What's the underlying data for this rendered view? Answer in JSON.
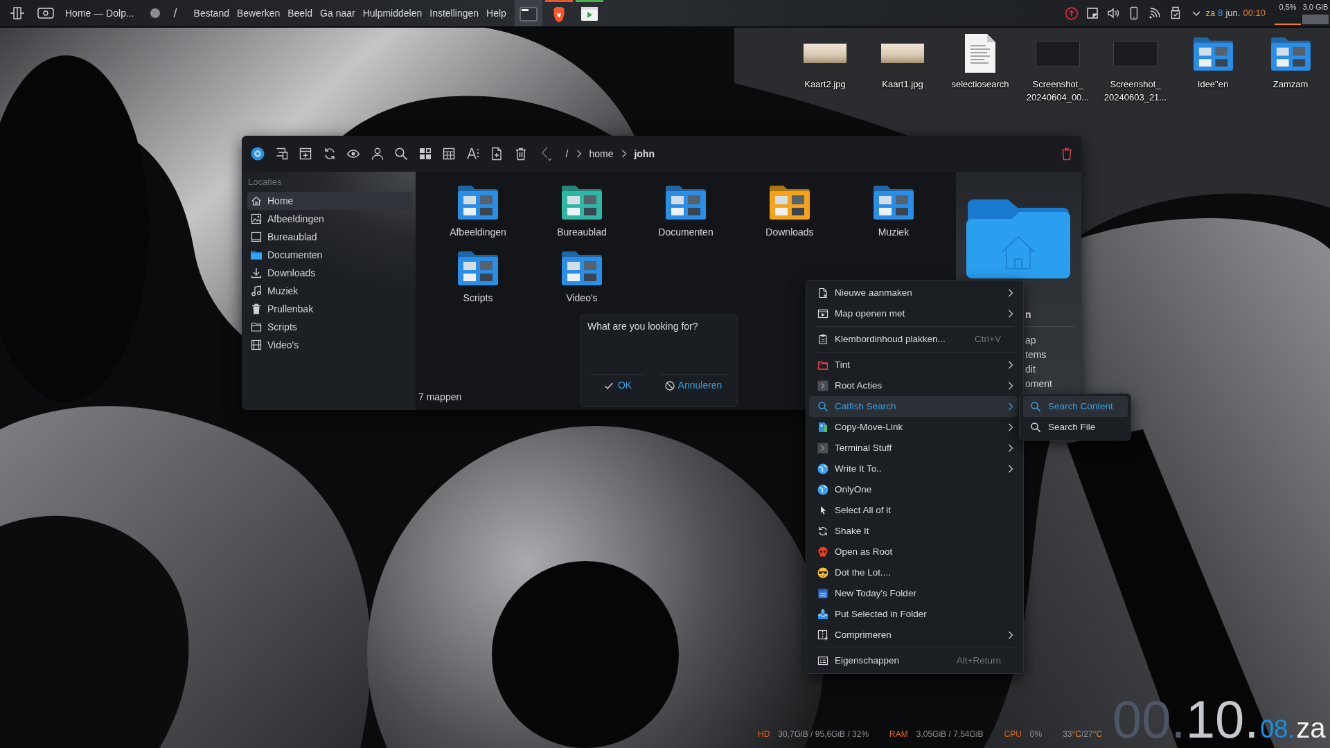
{
  "top_panel": {
    "window_title": "Home — Dolp...",
    "separator": "/",
    "menu": [
      "Bestand",
      "Bewerken",
      "Beeld",
      "Ga naar",
      "Hulpmiddelen",
      "Instellingen",
      "Help"
    ],
    "tasks": [
      {
        "selected": true
      },
      {
        "selected": false,
        "color": "#e4572e"
      },
      {
        "selected": false,
        "color": "#4caf50"
      }
    ],
    "datetime": {
      "weekday": "za",
      "day": "8",
      "month": "jun.",
      "time": "00:10"
    },
    "cpu_usage": "0,5%",
    "memory_usage": "3,0 GiB"
  },
  "desktop_icons": [
    {
      "kind": "photo",
      "label": [
        "Kaart2.jpg"
      ]
    },
    {
      "kind": "photo",
      "label": [
        "Kaart1.jpg"
      ]
    },
    {
      "kind": "document",
      "label": [
        "selectiosearch"
      ]
    },
    {
      "kind": "screenshot",
      "label": [
        "Screenshot_",
        "20240604_00..."
      ]
    },
    {
      "kind": "screenshot",
      "label": [
        "Screenshot_",
        "20240603_21..."
      ]
    },
    {
      "kind": "folder",
      "label": [
        "Idee\"en"
      ]
    },
    {
      "kind": "folder",
      "label": [
        "Zamzam"
      ]
    }
  ],
  "file_manager": {
    "breadcrumb": {
      "root": "/",
      "crumbs": [
        {
          "label": "home",
          "selected": false
        },
        {
          "label": "john",
          "selected": true
        }
      ]
    },
    "sidebar": {
      "heading": "Locaties",
      "items": [
        {
          "label": "Home",
          "selected": true
        },
        {
          "label": "Afbeeldingen",
          "selected": false
        },
        {
          "label": "Bureaublad",
          "selected": false
        },
        {
          "label": "Documenten",
          "selected": false
        },
        {
          "label": "Downloads",
          "selected": false
        },
        {
          "label": "Muziek",
          "selected": false
        },
        {
          "label": "Prullenbak",
          "selected": false
        },
        {
          "label": "Scripts",
          "selected": false
        },
        {
          "label": "Video's",
          "selected": false
        }
      ]
    },
    "folders": [
      {
        "label": "Afbeeldingen",
        "color": "#2a8ee6"
      },
      {
        "label": "Bureaublad",
        "color": "#2fb7a4"
      },
      {
        "label": "Documenten",
        "color": "#2a8ee6"
      },
      {
        "label": "Downloads",
        "color": "#f5a31a"
      },
      {
        "label": "Muziek",
        "color": "#2a8ee6"
      },
      {
        "label": "Scripts",
        "color": "#2a8ee6"
      },
      {
        "label": "Video's",
        "color": "#2a8ee6"
      }
    ],
    "status": "7 mappen",
    "info_panel": {
      "lines": [
        {
          "kind": "title",
          "text": "n"
        },
        {
          "kind": "text",
          "text": "ap"
        },
        {
          "kind": "text",
          "text": "tems"
        },
        {
          "kind": "text",
          "text": "dit"
        },
        {
          "kind": "text",
          "text": "oment"
        }
      ]
    }
  },
  "search_dialog": {
    "prompt": "What are you looking for?",
    "buttons": [
      {
        "kind": "ok",
        "label": "OK"
      },
      {
        "kind": "cancel",
        "label": "Annuleren"
      }
    ]
  },
  "context_menu": {
    "items": [
      {
        "kind": "item",
        "label": "Nieuwe aanmaken",
        "submenu": true,
        "selected": false
      },
      {
        "kind": "item",
        "label": "Map openen met",
        "submenu": true,
        "selected": false
      },
      {
        "kind": "separator"
      },
      {
        "kind": "item",
        "label": "Klembordinhoud plakken...",
        "shortcut": "Ctrl+V",
        "submenu": false,
        "selected": false
      },
      {
        "kind": "separator"
      },
      {
        "kind": "item",
        "label": "Tint",
        "submenu": true,
        "selected": false
      },
      {
        "kind": "item",
        "label": "Root Acties",
        "submenu": true,
        "selected": false
      },
      {
        "kind": "item",
        "label": "Catfish Search",
        "submenu": true,
        "selected": true
      },
      {
        "kind": "item",
        "label": "Copy-Move-Link",
        "submenu": true,
        "selected": false
      },
      {
        "kind": "item",
        "label": "Terminal Stuff",
        "submenu": true,
        "selected": false
      },
      {
        "kind": "item",
        "label": "Write It To..",
        "submenu": true,
        "selected": false
      },
      {
        "kind": "item",
        "label": "OnlyOne",
        "submenu": false,
        "selected": false
      },
      {
        "kind": "item",
        "label": "Select All of it",
        "submenu": false,
        "selected": false
      },
      {
        "kind": "item",
        "label": "Shake It",
        "submenu": false,
        "selected": false
      },
      {
        "kind": "item",
        "label": "Open as Root",
        "submenu": false,
        "selected": false
      },
      {
        "kind": "item",
        "label": "Dot the Lot....",
        "submenu": false,
        "selected": false
      },
      {
        "kind": "item",
        "label": "New Today's Folder",
        "submenu": false,
        "selected": false
      },
      {
        "kind": "item",
        "label": "Put Selected in Folder",
        "submenu": false,
        "selected": false
      },
      {
        "kind": "item",
        "label": "Comprimeren",
        "submenu": true,
        "selected": false
      },
      {
        "kind": "separator"
      },
      {
        "kind": "item",
        "label": "Eigenschappen",
        "shortcut": "Alt+Return",
        "submenu": false,
        "selected": false
      }
    ]
  },
  "submenu": {
    "items": [
      {
        "label": "Search Content",
        "selected": true
      },
      {
        "label": "Search File",
        "selected": false
      }
    ]
  },
  "system_monitor": {
    "stats": [
      {
        "label": "HD",
        "value": "30,7GiB / 95,6GiB / 32%"
      },
      {
        "label": "RAM",
        "value": "3,05GiB / 7,54GiB"
      },
      {
        "label": "CPU",
        "value": "0%"
      }
    ],
    "temperature": [
      {
        "kind": "number",
        "text": "33"
      },
      {
        "kind": "unit",
        "text": "°C"
      },
      {
        "kind": "number",
        "text": "/27"
      },
      {
        "kind": "unit",
        "text": "°C"
      }
    ]
  },
  "clock": {
    "hours": "00.",
    "minutes": "10.",
    "day": "08.",
    "weekday": "za"
  }
}
